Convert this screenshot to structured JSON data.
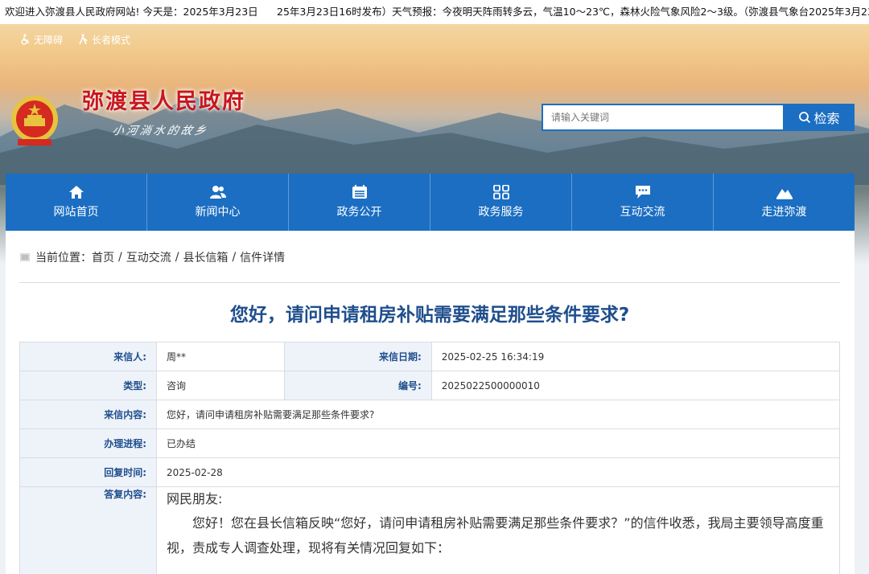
{
  "ticker": {
    "left": "欢迎进入弥渡县人民政府网站! 今天是：2025年3月23日",
    "right": "25年3月23日16时发布）天气预报：今夜明天阵雨转多云，气温10～23℃，森林火险气象风险2～3级。（弥渡县气象台2025年3月23"
  },
  "accessibility": {
    "barrier_free": "无障碍",
    "elder_mode": "长者模式"
  },
  "header": {
    "site_title": "弥渡县人民政府",
    "slogan": "小河淌水的故乡"
  },
  "search": {
    "placeholder": "请输入关键词",
    "button": "检索"
  },
  "nav": [
    {
      "label": "网站首页",
      "icon": "home-icon"
    },
    {
      "label": "新闻中心",
      "icon": "people-icon"
    },
    {
      "label": "政务公开",
      "icon": "calendar-list-icon"
    },
    {
      "label": "政务服务",
      "icon": "grid-apps-icon"
    },
    {
      "label": "互动交流",
      "icon": "chat-bubble-icon"
    },
    {
      "label": "走进弥渡",
      "icon": "mountain-icon"
    }
  ],
  "breadcrumb": {
    "prefix": "当前位置：",
    "items": [
      "首页",
      "互动交流",
      "县长信箱",
      "信件详情"
    ],
    "separator": "/"
  },
  "letter": {
    "title": "您好，请问申请租房补贴需要满足那些条件要求?",
    "sender_label": "来信人:",
    "sender": "周**",
    "date_label": "来信日期:",
    "date": "2025-02-25 16:34:19",
    "type_label": "类型:",
    "type": "咨询",
    "number_label": "编号:",
    "number": "2025022500000010",
    "content_label": "来信内容:",
    "content": "您好，请问申请租房补贴需要满足那些条件要求?",
    "progress_label": "办理进程:",
    "progress": "已办结",
    "reply_time_label": "回复时间:",
    "reply_time": "2025-02-28",
    "reply_label": "答复内容:",
    "reply_greeting": "网民朋友:",
    "reply_body": "您好！您在县长信箱反映“您好，请问申请租房补贴需要满足那些条件要求？”的信件收悉，我局主要领导高度重视，责成专人调查处理，现将有关情况回复如下："
  },
  "colors": {
    "primary": "#1b6ec2",
    "title_red": "#c8161d",
    "headline_blue": "#1f4e8c",
    "label_bg": "#eef3f9"
  }
}
